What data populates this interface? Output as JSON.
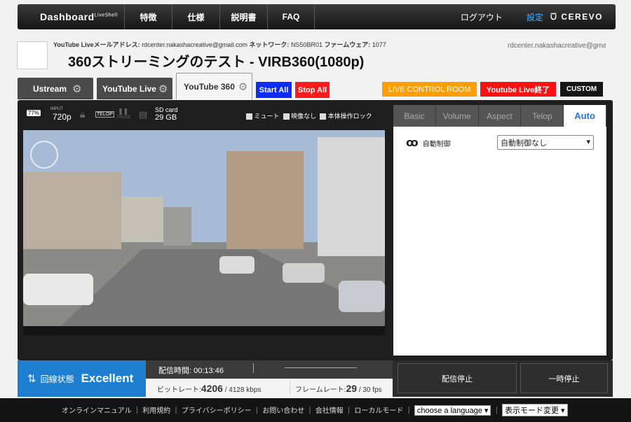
{
  "nav": {
    "brand": "Dashboard",
    "brand_sup": "LiveShell",
    "items": [
      "特徴",
      "仕様",
      "説明書",
      "FAQ"
    ],
    "logout": "ログアウト",
    "settings": "設定",
    "logo": "CEREVO"
  },
  "info": {
    "yt_label": "YouTube Liveメールアドレス:",
    "yt_email": "rdcenter.nakashacreative@gmail.com",
    "net_label": "ネットワーク:",
    "net_value": "NS50BR01",
    "fw_label": "ファームウェア:",
    "fw_value": "1077",
    "right_email": "rdcenter.nakashacreative@gmail.com"
  },
  "title": "360ストリーミングのテスト - VIRB360(1080p)",
  "tabs": {
    "ustream": "Ustream",
    "youtube_live": "YouTube Live",
    "youtube360": "YouTube 360"
  },
  "buttons": {
    "start_all": "Start All",
    "stop_all": "Stop All",
    "live_control": "LIVE CONTROL ROOM",
    "yt_end": "Youtube Live終了",
    "custom": "CUSTOM"
  },
  "status": {
    "pct": "77%",
    "input_label": "INPUT",
    "input": "720p",
    "telop": "TELOP",
    "pause": "PAUSE",
    "sd_label": "SD card",
    "sd": "29 GB",
    "mute": "ミュート",
    "no_video": "映像なし",
    "lock": "本体操作ロック"
  },
  "right": {
    "tabs": [
      "Basic",
      "Volume",
      "Aspect",
      "Telop",
      "Auto"
    ],
    "auto_label": "自動制御",
    "auto_select": "自動制御なし"
  },
  "bottom": {
    "conn_label": "回線状態",
    "conn_value": "Excellent",
    "time_label": "配信時間:",
    "time": "00:13:46",
    "bitrate_label": "ビットレート:",
    "bitrate": "4206",
    "bitrate_max": "/ 4128 kbps",
    "fps_label": "フレームレート:",
    "fps": "29",
    "fps_max": "/ 30 fps",
    "stop": "配信停止",
    "pause": "一時停止"
  },
  "footer": {
    "links": [
      "オンラインマニュアル",
      "利用規約",
      "プライバシーポリシー",
      "お問い合わせ",
      "会社情報",
      "ローカルモード"
    ],
    "lang": "choose a language",
    "mode": "表示モード変更"
  },
  "colors": {
    "accent": "#1e7fd0",
    "start": "#0b2bff",
    "stop": "#ff1b1b",
    "control": "#ff9e00",
    "ytend": "#ff1111"
  }
}
